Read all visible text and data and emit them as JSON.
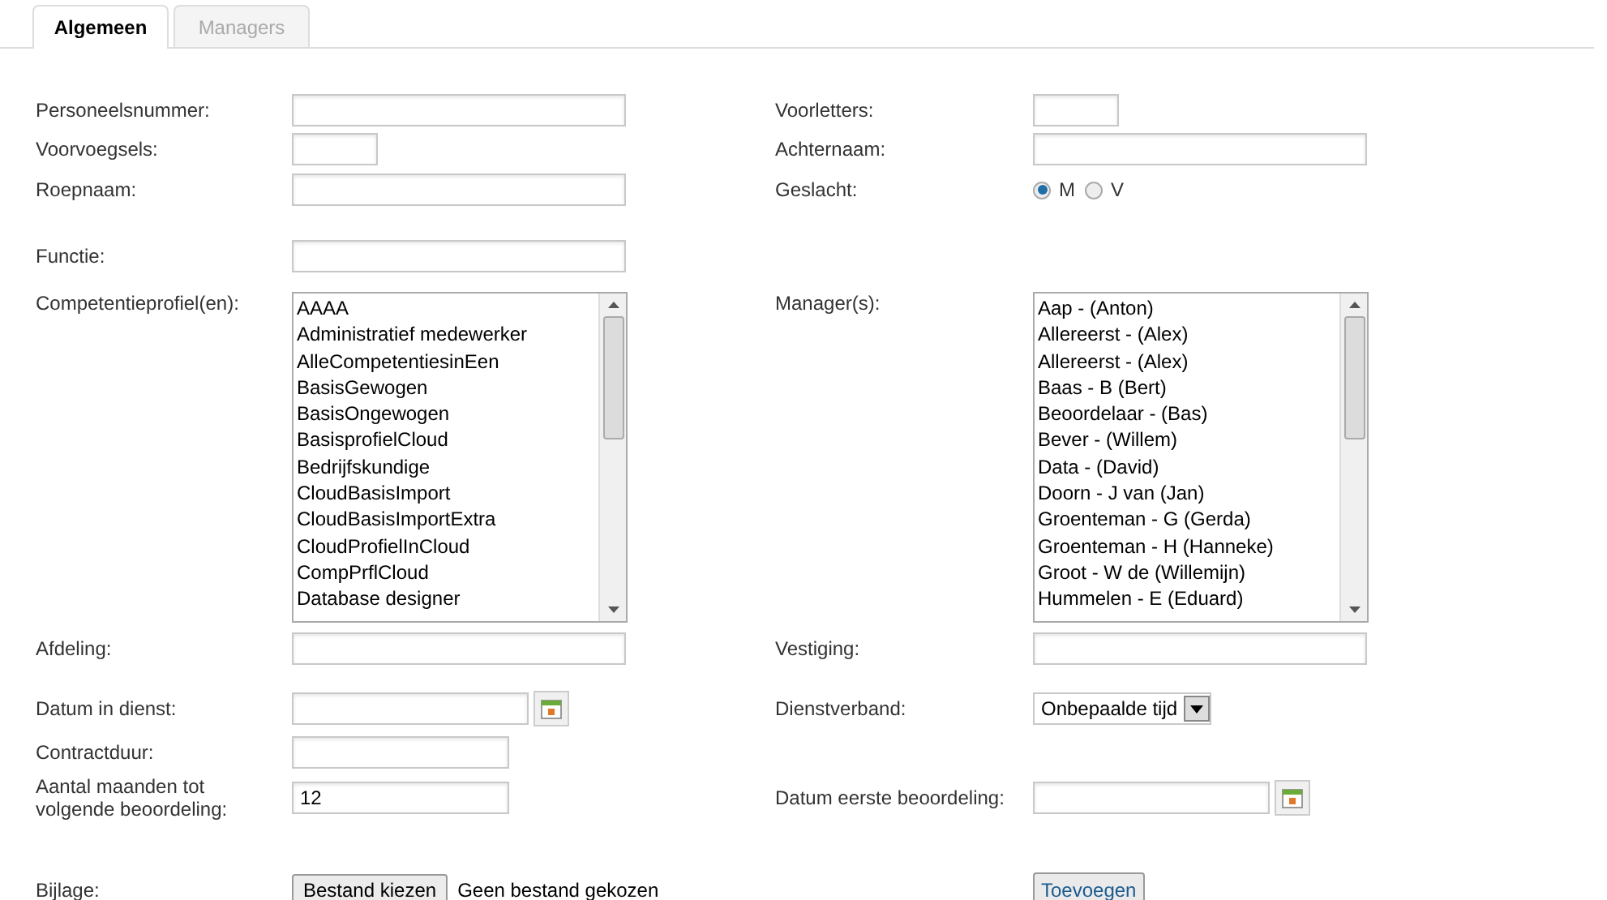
{
  "tabs": [
    {
      "label": "Algemeen",
      "selected": true
    },
    {
      "label": "Managers",
      "selected": false
    }
  ],
  "rows": [
    {
      "left": {
        "label": "Personeelsnummer:",
        "kind": "text"
      },
      "right": {
        "label": "Voorletters:",
        "kind": "text"
      }
    },
    {
      "left": {
        "label": "Voorvoegsels:",
        "kind": "text"
      },
      "right": {
        "label": "Achternaam:",
        "kind": "text"
      }
    },
    {
      "left": {
        "label": "Roepnaam:",
        "kind": "text"
      },
      "right": {
        "label": "Geslacht:",
        "kind": "radio",
        "options": [
          {
            "label": "M",
            "selected": true
          },
          {
            "label": "V",
            "selected": false
          }
        ]
      }
    },
    {
      "left": {
        "label": "Functie:",
        "kind": "text"
      }
    },
    {
      "left": {
        "label": "Competentieprofiel(en):",
        "kind": "list",
        "items": [
          "AAAA",
          "Administratief medewerker",
          "AlleCompetentiesinEen",
          "BasisGewogen",
          "BasisOngewogen",
          "BasisprofielCloud",
          "Bedrijfskundige",
          "CloudBasisImport",
          "CloudBasisImportExtra",
          "CloudProfielInCloud",
          "CompPrflCloud",
          "Database designer"
        ]
      },
      "right": {
        "label": "Manager(s):",
        "kind": "list",
        "items": [
          "Aap - (Anton)",
          "Allereerst - (Alex)",
          "Allereerst - (Alex)",
          "Baas - B (Bert)",
          "Beoordelaar - (Bas)",
          "Bever - (Willem)",
          "Data - (David)",
          "Doorn - J van (Jan)",
          "Groenteman - G (Gerda)",
          "Groenteman - H (Hanneke)",
          "Groot - W de (Willemijn)",
          "Hummelen - E (Eduard)"
        ]
      }
    },
    {
      "left": {
        "label": "Afdeling:",
        "kind": "text"
      },
      "right": {
        "label": "Vestiging:",
        "kind": "text"
      }
    },
    {
      "left": {
        "label": "Datum in dienst:",
        "kind": "date"
      },
      "right": {
        "label": "Dienstverband:",
        "kind": "select",
        "value": "Onbepaalde tijd"
      }
    },
    {
      "left": {
        "label": "Contractduur:",
        "kind": "text"
      }
    },
    {
      "left": {
        "label": "Aantal maanden tot volgende beoordeling:",
        "kind": "text",
        "value": "12"
      },
      "right": {
        "label": "Datum eerste beoordeling:",
        "kind": "date"
      }
    },
    {
      "left": {
        "label": "Bijlage:",
        "kind": "file",
        "button": "Bestand kiezen",
        "status": "Geen bestand gekozen"
      },
      "right": {
        "kind": "button",
        "button": "Toevoegen"
      }
    }
  ]
}
